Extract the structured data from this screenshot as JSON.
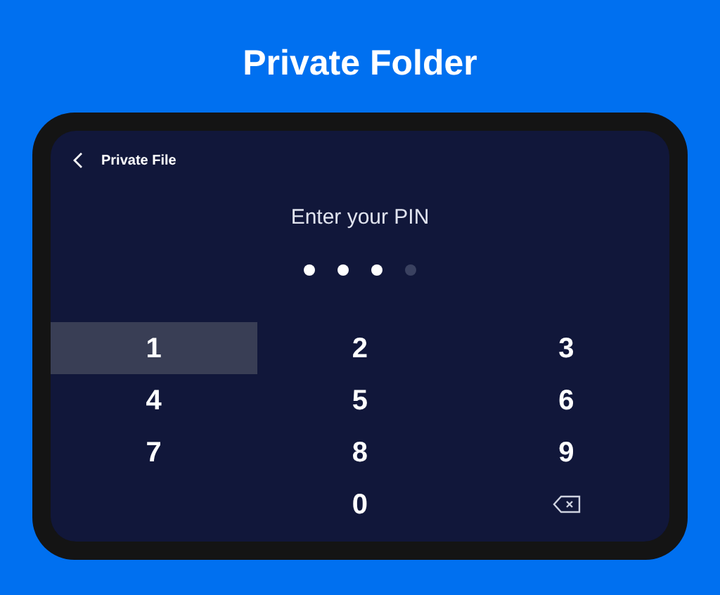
{
  "title": "Private Folder",
  "header": {
    "title": "Private File"
  },
  "prompt": "Enter your PIN",
  "pin_dots": [
    {
      "filled": true
    },
    {
      "filled": true
    },
    {
      "filled": true
    },
    {
      "filled": false
    }
  ],
  "keys": [
    {
      "kind": "digit",
      "label": "1",
      "selected": true
    },
    {
      "kind": "digit",
      "label": "2",
      "selected": false
    },
    {
      "kind": "digit",
      "label": "3",
      "selected": false
    },
    {
      "kind": "digit",
      "label": "4",
      "selected": false
    },
    {
      "kind": "digit",
      "label": "5",
      "selected": false
    },
    {
      "kind": "digit",
      "label": "6",
      "selected": false
    },
    {
      "kind": "digit",
      "label": "7",
      "selected": false
    },
    {
      "kind": "digit",
      "label": "8",
      "selected": false
    },
    {
      "kind": "digit",
      "label": "9",
      "selected": false
    },
    {
      "kind": "empty"
    },
    {
      "kind": "digit",
      "label": "0",
      "selected": false
    },
    {
      "kind": "backspace",
      "selected": false
    }
  ]
}
